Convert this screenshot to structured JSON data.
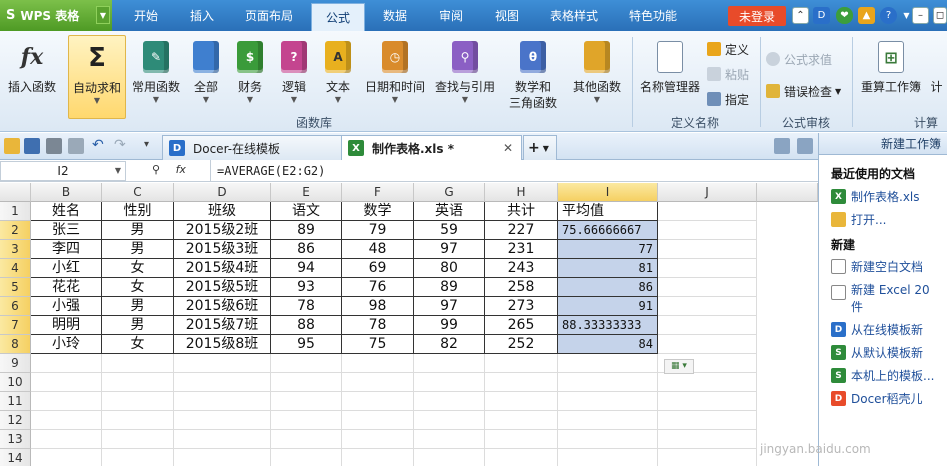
{
  "menubar": {
    "app_button": "WPS 表格",
    "tabs": [
      "开始",
      "插入",
      "页面布局",
      "公式",
      "数据",
      "审阅",
      "视图",
      "表格样式",
      "特色功能"
    ],
    "active_tab": "公式",
    "login": "未登录"
  },
  "ribbon": {
    "buttons": {
      "insert_function": "插入函数",
      "autosum": "自动求和",
      "common": "常用函数",
      "all": "全部",
      "finance": "财务",
      "logic": "逻辑",
      "text": "文本",
      "datetime": "日期和时间",
      "lookup": "查找与引用",
      "math_line1": "数学和",
      "math_line2": "三角函数",
      "other": "其他函数",
      "name_manager": "名称管理器",
      "define": "定义",
      "paste": "粘贴",
      "specify": "指定",
      "formula_eval": "公式求值",
      "error_check": "错误检查",
      "recalc": "重算工作簿",
      "calc": "计"
    },
    "groups": {
      "library": "函数库",
      "defined_names": "定义名称",
      "audit": "公式审核",
      "calculation": "计算"
    }
  },
  "tabs": {
    "docer": "Docer-在线模板",
    "current": "制作表格.xls *"
  },
  "formula_bar": {
    "name_box": "I2",
    "formula": "=AVERAGE(E2:G2)"
  },
  "sheet": {
    "columns": [
      "B",
      "C",
      "D",
      "E",
      "F",
      "G",
      "H",
      "I",
      "J"
    ],
    "rows": [
      "1",
      "2",
      "3",
      "4",
      "5",
      "6",
      "7",
      "8",
      "9",
      "10",
      "11",
      "12",
      "13",
      "14"
    ],
    "data": [
      [
        "姓名",
        "性别",
        "班级",
        "语文",
        "数学",
        "英语",
        "共计",
        "平均值"
      ],
      [
        "张三",
        "男",
        "2015级2班",
        "89",
        "79",
        "59",
        "227",
        "75.66666667"
      ],
      [
        "李四",
        "男",
        "2015级3班",
        "86",
        "48",
        "97",
        "231",
        "77"
      ],
      [
        "小红",
        "女",
        "2015级4班",
        "94",
        "69",
        "80",
        "243",
        "81"
      ],
      [
        "花花",
        "女",
        "2015级5班",
        "93",
        "76",
        "89",
        "258",
        "86"
      ],
      [
        "小强",
        "男",
        "2015级6班",
        "78",
        "98",
        "97",
        "273",
        "91"
      ],
      [
        "明明",
        "男",
        "2015级7班",
        "88",
        "78",
        "99",
        "265",
        "88.33333333"
      ],
      [
        "小玲",
        "女",
        "2015级8班",
        "95",
        "75",
        "82",
        "252",
        "84"
      ]
    ]
  },
  "taskpane": {
    "title": "新建工作簿",
    "recent_heading": "最近使用的文档",
    "recent": [
      "制作表格.xls",
      "打开..."
    ],
    "new_heading": "新建",
    "new_items": [
      "新建空白文档",
      "新建 Excel 20",
      "件",
      "从在线模板新",
      "从默认模板新",
      "本机上的模板...",
      "Docer稻壳儿"
    ]
  },
  "watermark": "jingyan.baidu.com"
}
